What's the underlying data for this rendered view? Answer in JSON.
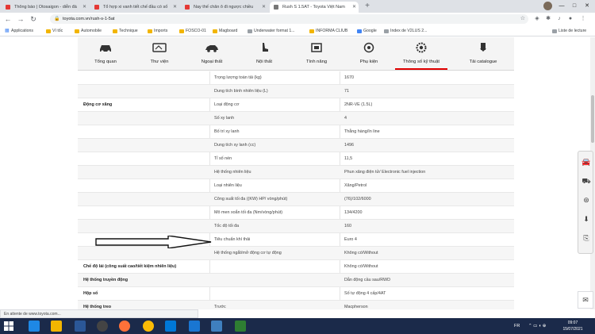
{
  "browser": {
    "tabs": [
      {
        "title": "Thông báo | Otosaigon - diễn đà",
        "active": false,
        "favicon_color": "#e53935"
      },
      {
        "title": "Tổ hợp xi vanh tiết chế đầu có số",
        "active": false,
        "favicon_color": "#e53935"
      },
      {
        "title": "Nay thế chân ô đi ngược chiều",
        "active": false,
        "favicon_color": "#e53935"
      },
      {
        "title": "Rush S 1.5AT - Toyota Việt Nam",
        "active": true,
        "favicon_color": "#777777"
      }
    ],
    "new_tab": "+",
    "url": "toyota.com.vn/rush-s-1-5at",
    "window_controls": [
      "—",
      "□",
      "✕"
    ]
  },
  "bookmarks": [
    {
      "label": "Applications",
      "icon": "apps-icon"
    },
    {
      "label": "Ví tốc",
      "icon": "folder-icon"
    },
    {
      "label": "Automobile",
      "icon": "folder-icon"
    },
    {
      "label": "Technique",
      "icon": "folder-icon"
    },
    {
      "label": "Imports",
      "icon": "folder-icon"
    },
    {
      "label": "FOSCO-01",
      "icon": "folder-icon"
    },
    {
      "label": "Magboard",
      "icon": "folder-icon"
    },
    {
      "label": "Underwater format 1...",
      "icon": "globe-icon"
    },
    {
      "label": "INFORMA CLIUB",
      "icon": "folder-icon"
    },
    {
      "label": "Google",
      "icon": "google-icon"
    },
    {
      "label": "Index de V2LUS 2...",
      "icon": "globe-icon"
    }
  ],
  "bookmarks_other": "Liste de lecture",
  "site_nav": [
    {
      "label": "Tổng quan",
      "icon": "car-icon",
      "active": false
    },
    {
      "label": "Thư viện",
      "icon": "gallery-icon",
      "active": false
    },
    {
      "label": "Ngoại thất",
      "icon": "car-side-icon",
      "active": false
    },
    {
      "label": "Nội thất",
      "icon": "seat-icon",
      "active": false
    },
    {
      "label": "Tính năng",
      "icon": "feature-icon",
      "active": false
    },
    {
      "label": "Phụ kiện",
      "icon": "accessory-icon",
      "active": false
    },
    {
      "label": "Thông số kỹ thuật",
      "icon": "gear-icon",
      "active": true
    },
    {
      "label": "Tải catalogue",
      "icon": "download-icon",
      "active": false
    }
  ],
  "specs": [
    {
      "group": "",
      "name": "Trọng lượng toàn tải (kg)",
      "value": "1670"
    },
    {
      "group": "",
      "name": "Dung tích bình nhiên liệu (L)",
      "value": "71"
    },
    {
      "group": "Động cơ xăng",
      "name": "Loại động cơ",
      "value": "2NR-VE (1.5L)"
    },
    {
      "group": "",
      "name": "Số xy lanh",
      "value": "4"
    },
    {
      "group": "",
      "name": "Bố trí xy lanh",
      "value": "Thẳng hàng/In line"
    },
    {
      "group": "",
      "name": "Dung tích xy lanh (cc)",
      "value": "1496"
    },
    {
      "group": "",
      "name": "Tỉ số nén",
      "value": "11,5"
    },
    {
      "group": "",
      "name": "Hệ thống nhiên liệu",
      "value": "Phun xăng điện tử/ Electronic fuel injection"
    },
    {
      "group": "",
      "name": "Loại nhiên liệu",
      "value": "Xăng/Petrol"
    },
    {
      "group": "",
      "name": "Công suất tối đa ((KW) HP/ vòng/phút)",
      "value": "(76)/102/6000"
    },
    {
      "group": "",
      "name": "Mô men xoắn tối đa (Nm/vòng/phút)",
      "value": "134/4200"
    },
    {
      "group": "",
      "name": "Tốc độ tối đa",
      "value": "160"
    },
    {
      "group": "",
      "name": "Tiêu chuẩn khí thải",
      "value": "Euro 4"
    },
    {
      "group": "",
      "name": "Hệ thống ngắt/mở động cơ tự động",
      "value": "Không có/Without"
    },
    {
      "group": "Chế độ lái (công suất cao/tiết kiệm nhiên liệu)",
      "name": "",
      "value": "Không có/Without"
    },
    {
      "group": "Hệ thống truyền động",
      "name": "",
      "value": "Dẫn động cầu sau/RWD"
    },
    {
      "group": "Hộp số",
      "name": "",
      "value": "Số tự động 4 cấp/4AT"
    },
    {
      "group": "Hệ thống treo",
      "name": "Trước",
      "value": "Macpherson"
    }
  ],
  "sidebar_buttons": [
    "car-icon",
    "car-front-icon",
    "steering-wheel-icon",
    "download-icon",
    "quote-icon"
  ],
  "status_text": "En attente de www.toyota.com...",
  "taskbar": {
    "lang": "FR",
    "time": "09:07",
    "date": "15/07/2021"
  }
}
